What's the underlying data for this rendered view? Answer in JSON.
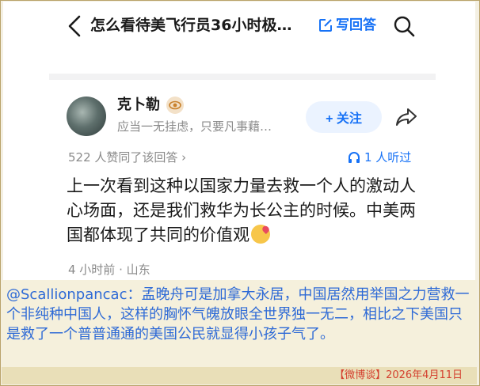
{
  "header": {
    "title": "怎么看待美飞行员36小时极…",
    "write_answer": "写回答"
  },
  "author": {
    "name": "克卜勒",
    "bio": "应当一无挂虑，只要凡事藉…",
    "follow_label": "+ 关注"
  },
  "answer": {
    "likes": "522 人赞同了该回答 ›",
    "listeners": "1 人听过",
    "content": "上一次看到这种以国家力量去救一个人的激动人心场面，还是我们救华为长公主的时候。中美两国都体现了共同的价值观",
    "time_location": "4 小时前 · 山东"
  },
  "overlay_comment": {
    "text": "@Scallionpancac：孟晚舟可是加拿大永居，中国居然用举国之力营救一个非纯种中国人，这样的胸怀气魄放眼全世界独一无二，相比之下美国只是救了一个普普通通的美国公民就显得小孩子气了。"
  },
  "footer": {
    "source_date": "【微博谈】2026年4月11日"
  },
  "colors": {
    "accent": "#1772f6",
    "comment_text": "#2e6ad6",
    "footer_text": "#d4402f",
    "frame": "#b9a36a"
  },
  "icons": [
    "back-arrow-icon",
    "edit-icon",
    "search-icon",
    "badge-icon",
    "share-icon",
    "headphones-icon",
    "kiss-emoji-icon"
  ]
}
